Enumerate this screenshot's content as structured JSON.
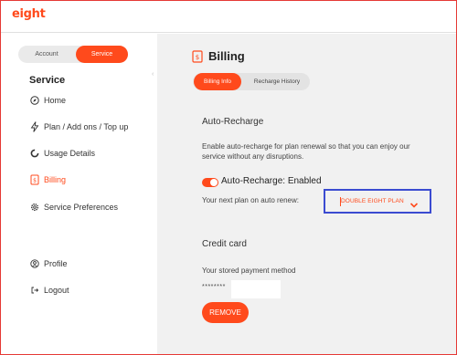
{
  "brand": {
    "logo_text": "eight",
    "accent": "#ff4a1c"
  },
  "sidebar": {
    "toggle": {
      "account_label": "Account",
      "service_label": "Service",
      "selected": "Service"
    },
    "title": "Service",
    "items": [
      {
        "label": "Home",
        "icon": "compass-icon"
      },
      {
        "label": "Plan / Add ons / Top up",
        "icon": "lightning-icon"
      },
      {
        "label": "Usage Details",
        "icon": "donut-chart-icon"
      },
      {
        "label": "Billing",
        "icon": "billing-document-icon",
        "active": true
      },
      {
        "label": "Service Preferences",
        "icon": "gear-icon"
      }
    ],
    "bottom_items": [
      {
        "label": "Profile",
        "icon": "user-icon"
      },
      {
        "label": "Logout",
        "icon": "logout-icon"
      }
    ]
  },
  "main": {
    "title": "Billing",
    "tabs": [
      {
        "label": "Billing Info",
        "active": true
      },
      {
        "label": "Recharge History",
        "active": false
      }
    ],
    "auto_recharge": {
      "heading": "Auto-Recharge",
      "description": "Enable auto-recharge for plan renewal so that you can enjoy our service without any disruptions.",
      "switch_label": "Auto-Recharge: Enabled",
      "enabled": true,
      "renew_label": "Your next plan on auto renew:",
      "selected_plan": "DOUBLE EIGHT PLAN"
    },
    "credit_card": {
      "heading": "Credit card",
      "stored_label": "Your stored payment method",
      "masked_number": "********",
      "remove_label": "REMOVE"
    }
  }
}
